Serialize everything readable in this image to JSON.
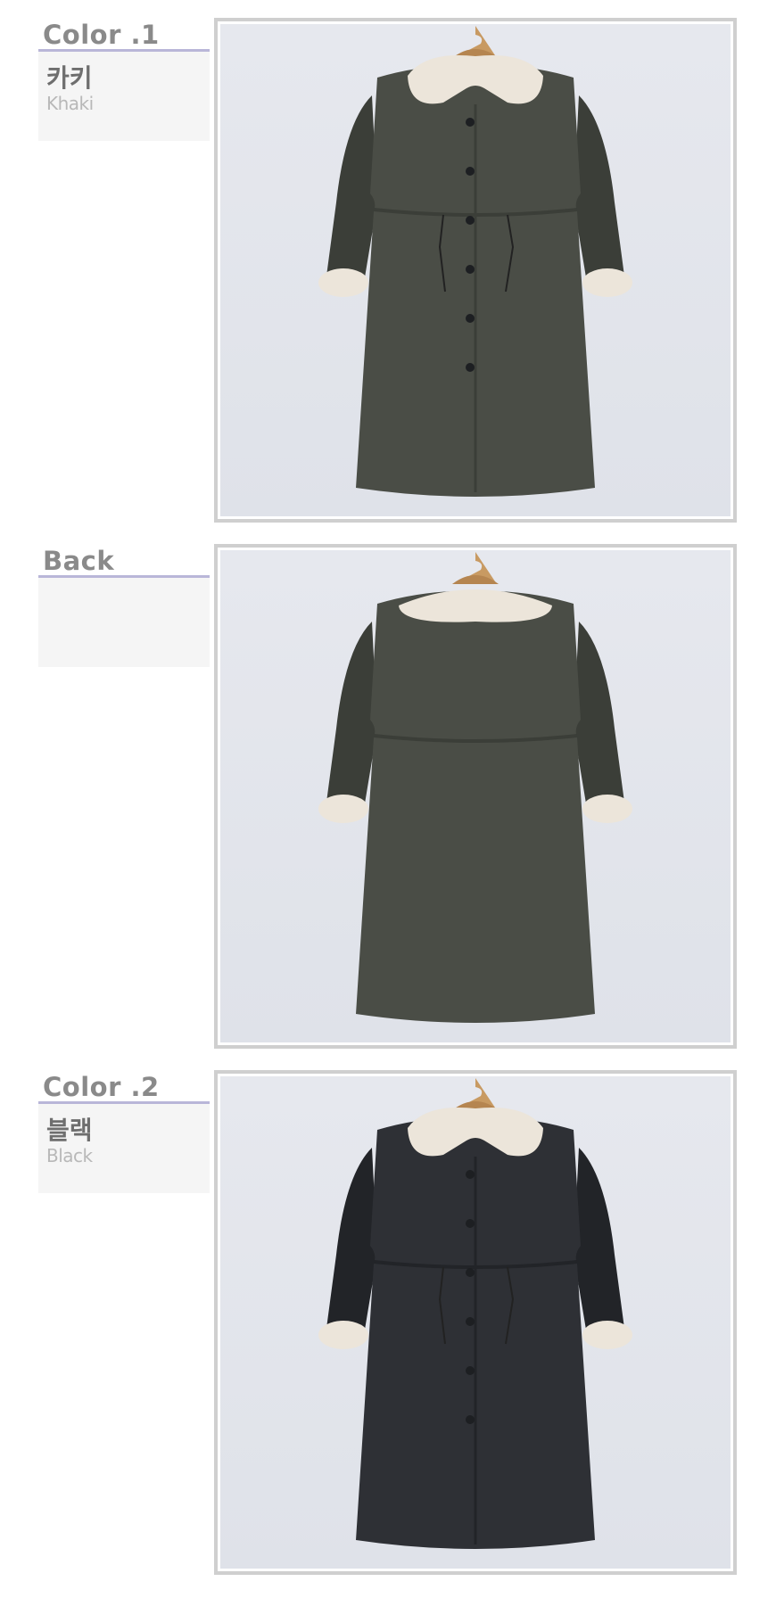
{
  "sections": [
    {
      "title": "Color .1",
      "name_ko": "카키",
      "name_en": "Khaki",
      "view": "front",
      "coat_color": "#4a4d46",
      "coat_shade": "#3b3e38"
    },
    {
      "title": "Back",
      "name_ko": "",
      "name_en": "",
      "view": "back",
      "coat_color": "#4a4d46",
      "coat_shade": "#3b3e38"
    },
    {
      "title": "Color .2",
      "name_ko": "블랙",
      "name_en": "Black",
      "view": "front",
      "coat_color": "#2e3035",
      "coat_shade": "#222428"
    }
  ],
  "colors": {
    "title_text": "#8a8a8a",
    "rule": "#b9b6d8",
    "label_bg": "#f5f5f5",
    "frame_border": "#cfcfcf",
    "fur": "#ece5da",
    "background": "#e3e6ec"
  }
}
